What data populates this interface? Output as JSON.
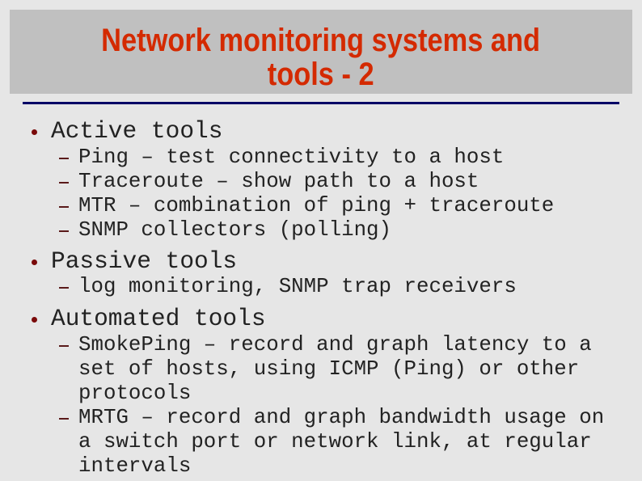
{
  "slide": {
    "title_lines": [
      "Network monitoring systems and",
      "tools - 2"
    ],
    "colors": {
      "title": "#d42a00",
      "title_background": "#c0c0c0",
      "separator": "#000066",
      "bullet": "#7a0a0a",
      "body_text": "#222222",
      "background": "#e6e6e6"
    },
    "sections": [
      {
        "heading": "Active tools",
        "items": [
          {
            "lines": [
              "Ping – test connectivity to a host"
            ]
          },
          {
            "lines": [
              "Traceroute – show path to a host"
            ]
          },
          {
            "lines": [
              "MTR – combination of ping + traceroute"
            ]
          },
          {
            "lines": [
              "SNMP collectors (polling)"
            ]
          }
        ]
      },
      {
        "heading": "Passive tools",
        "items": [
          {
            "lines": [
              "log monitoring, SNMP trap receivers"
            ]
          }
        ]
      },
      {
        "heading": "Automated tools",
        "items": [
          {
            "lines": [
              "SmokePing – record and graph latency to a",
              "set of hosts, using ICMP (Ping) or other",
              "protocols"
            ]
          },
          {
            "lines": [
              "MRTG – record and graph bandwidth usage on",
              "a switch port or network link, at regular",
              "intervals"
            ]
          }
        ]
      }
    ]
  }
}
